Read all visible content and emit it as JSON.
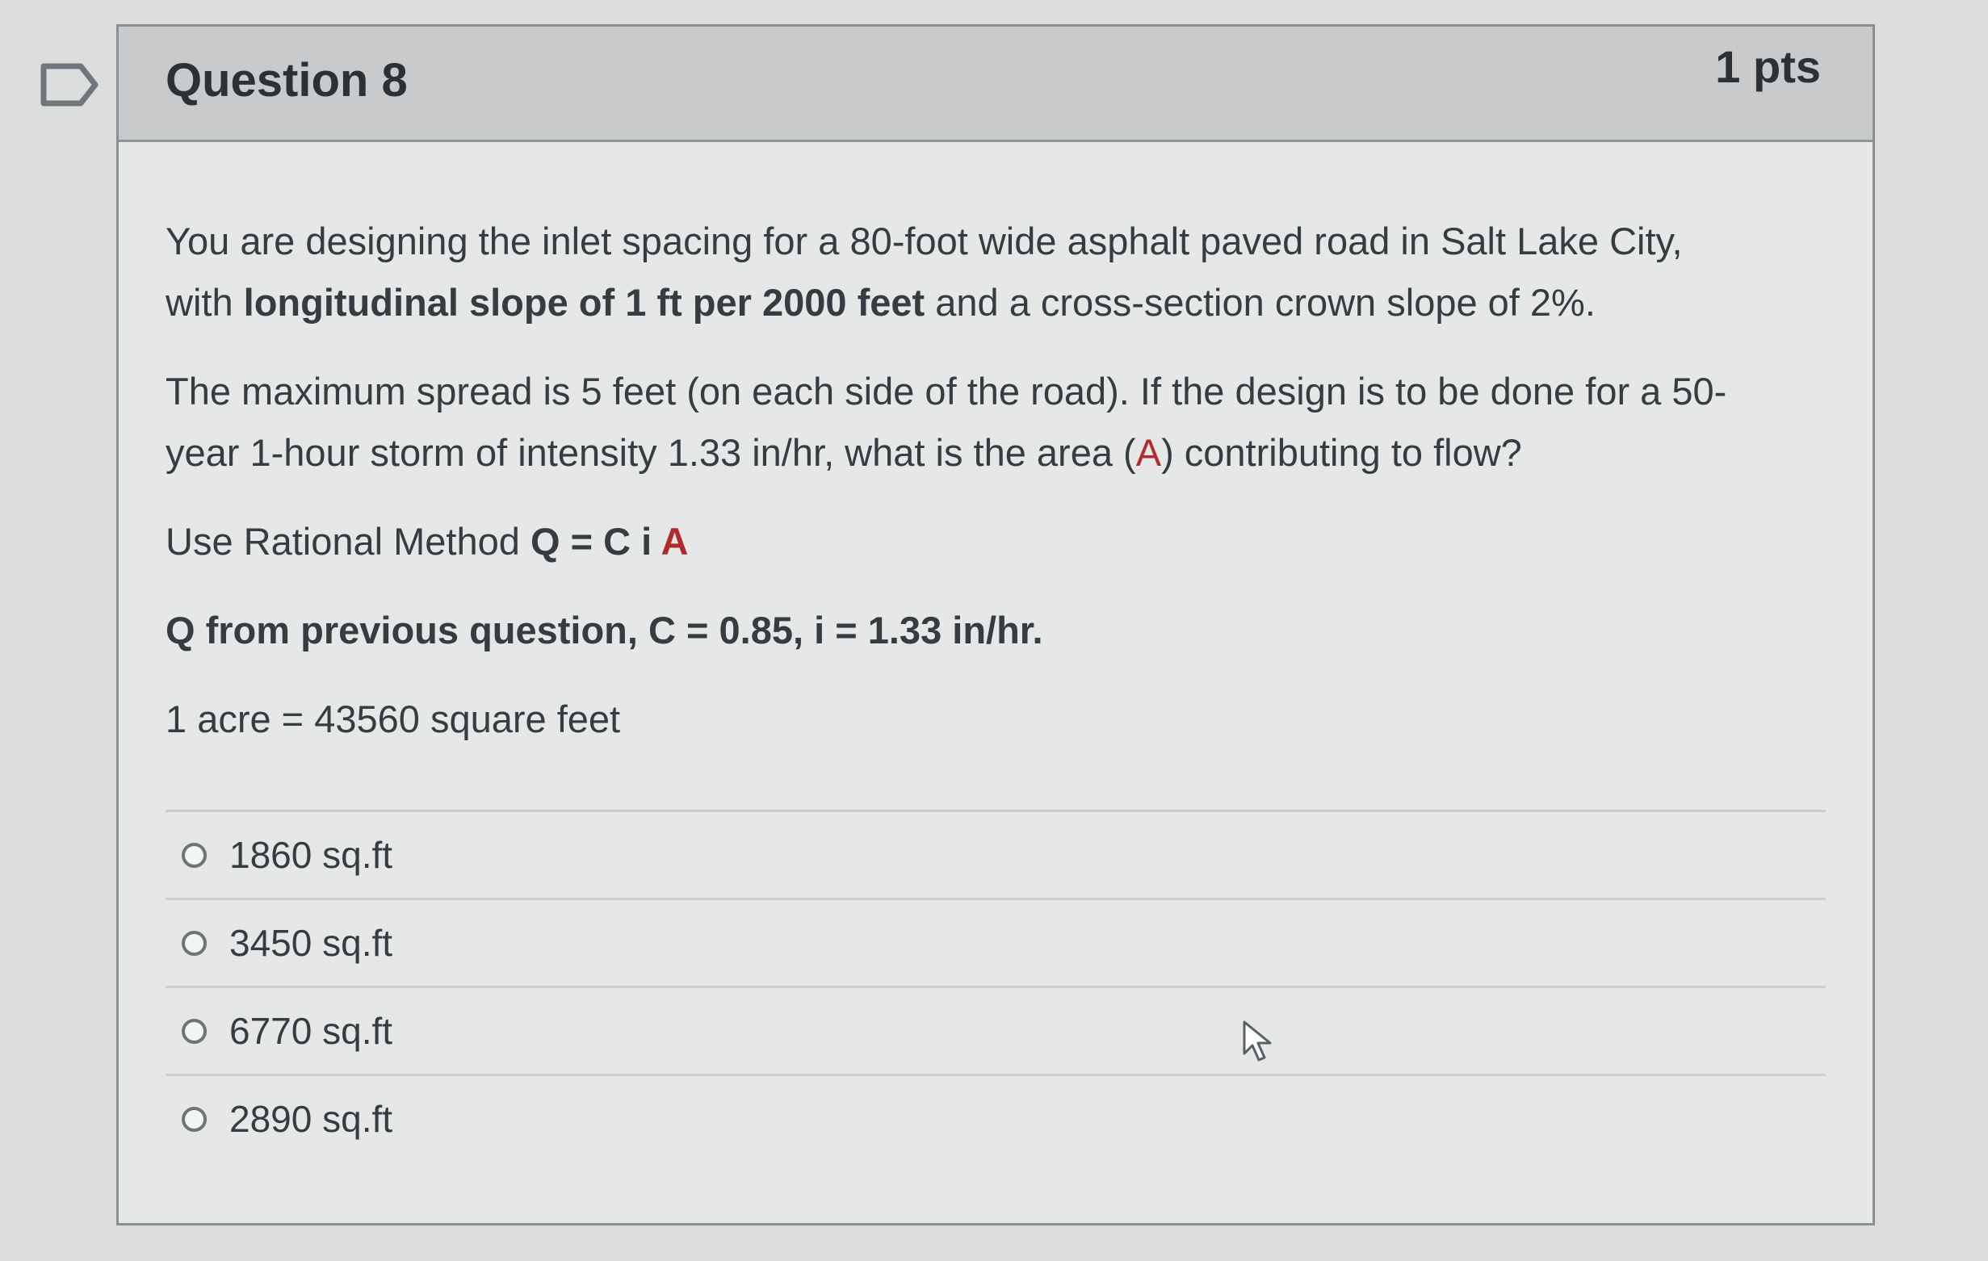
{
  "question": {
    "title": "Question 8",
    "points": "1 pts",
    "flag_icon": "flag-outline-icon",
    "paragraph1": {
      "part1": "You are designing the inlet spacing for a 80-foot wide asphalt paved road in Salt Lake City,",
      "part2": "with ",
      "bold": "longitudinal slope of 1 ft per 2000 feet",
      "part3": " and a cross-section crown slope of 2%."
    },
    "paragraph2": {
      "line1": "The maximum spread is 5 feet (on each side of the road). If the design is to be done for a 50-",
      "line2_before": "year 1-hour storm of intensity 1.33 in/hr, what is the area (",
      "highlight": "A",
      "line2_after": ") contributing to flow?"
    },
    "rational_method": {
      "prefix": "Use Rational Method ",
      "formula_main": "Q = C i ",
      "formula_highlight": "A"
    },
    "given_values": "Q from previous question, C = 0.85, i = 1.33 in/hr.",
    "conversion": "1 acre = 43560 square feet",
    "answers": [
      {
        "label": "1860 sq.ft"
      },
      {
        "label": "3450 sq.ft"
      },
      {
        "label": "6770 sq.ft"
      },
      {
        "label": "2890 sq.ft"
      }
    ]
  },
  "pointer": {
    "icon": "mouse-pointer-icon"
  },
  "colors": {
    "background": "#dcdedd",
    "card": "#e6e8e7",
    "header": "#c8cacb",
    "text": "#353d43",
    "highlight": "#b22b2b"
  }
}
